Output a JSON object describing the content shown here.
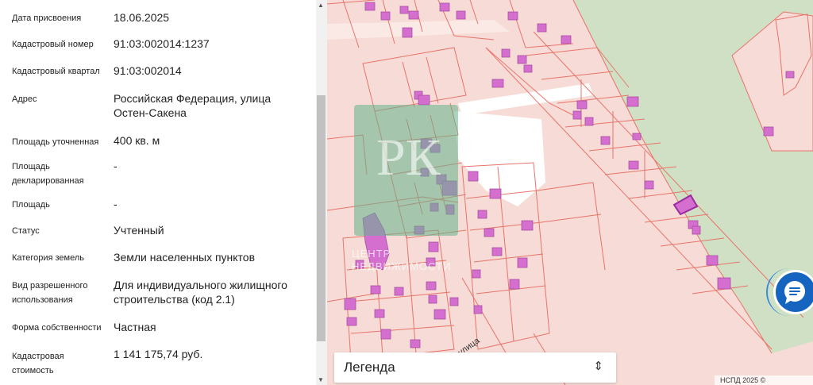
{
  "details": [
    {
      "label": "Дата присвоения",
      "value": "18.06.2025"
    },
    {
      "label": "Кадастровый номер",
      "value": "91:03:002014:1237"
    },
    {
      "label": "Кадастровый квартал",
      "value": "91:03:002014"
    },
    {
      "label": "Адрес",
      "value": "Российская Федерация, улица Остен-Сакена"
    },
    {
      "label": "Площадь уточненная",
      "value": "400 кв. м"
    },
    {
      "label": "Площадь декларированная",
      "value": "-"
    },
    {
      "label": "Площадь",
      "value": "-"
    },
    {
      "label": "Статус",
      "value": "Учтенный"
    },
    {
      "label": "Категория земель",
      "value": "Земли населенных пунктов"
    },
    {
      "label": "Вид разрешенного использования",
      "value": "Для индивидуального жилищного строительства (код 2.1)"
    },
    {
      "label": "Форма собственности",
      "value": "Частная"
    },
    {
      "label": "Кадастровая стоимость",
      "value": "1 141 175,74 руб."
    }
  ],
  "map": {
    "street_label": "улица",
    "watermark": {
      "letters": "РК",
      "line1": "ЦЕНТР",
      "line2": "НЕДВИЖИМОСТИ"
    },
    "legend_label": "Легенда",
    "attribution": "НСПД 2025 ©",
    "colors": {
      "parcel_fill": "#f6dbd6",
      "parcel_stroke": "#e8746a",
      "building": "#d46fd0",
      "forest": "#cfe0c4",
      "selected": "#9c2aa0",
      "chat_button": "#1565c0"
    }
  },
  "icons": {
    "legend_toggle": "chevron-up-down-icon",
    "chat": "chat-bubble-icon"
  }
}
